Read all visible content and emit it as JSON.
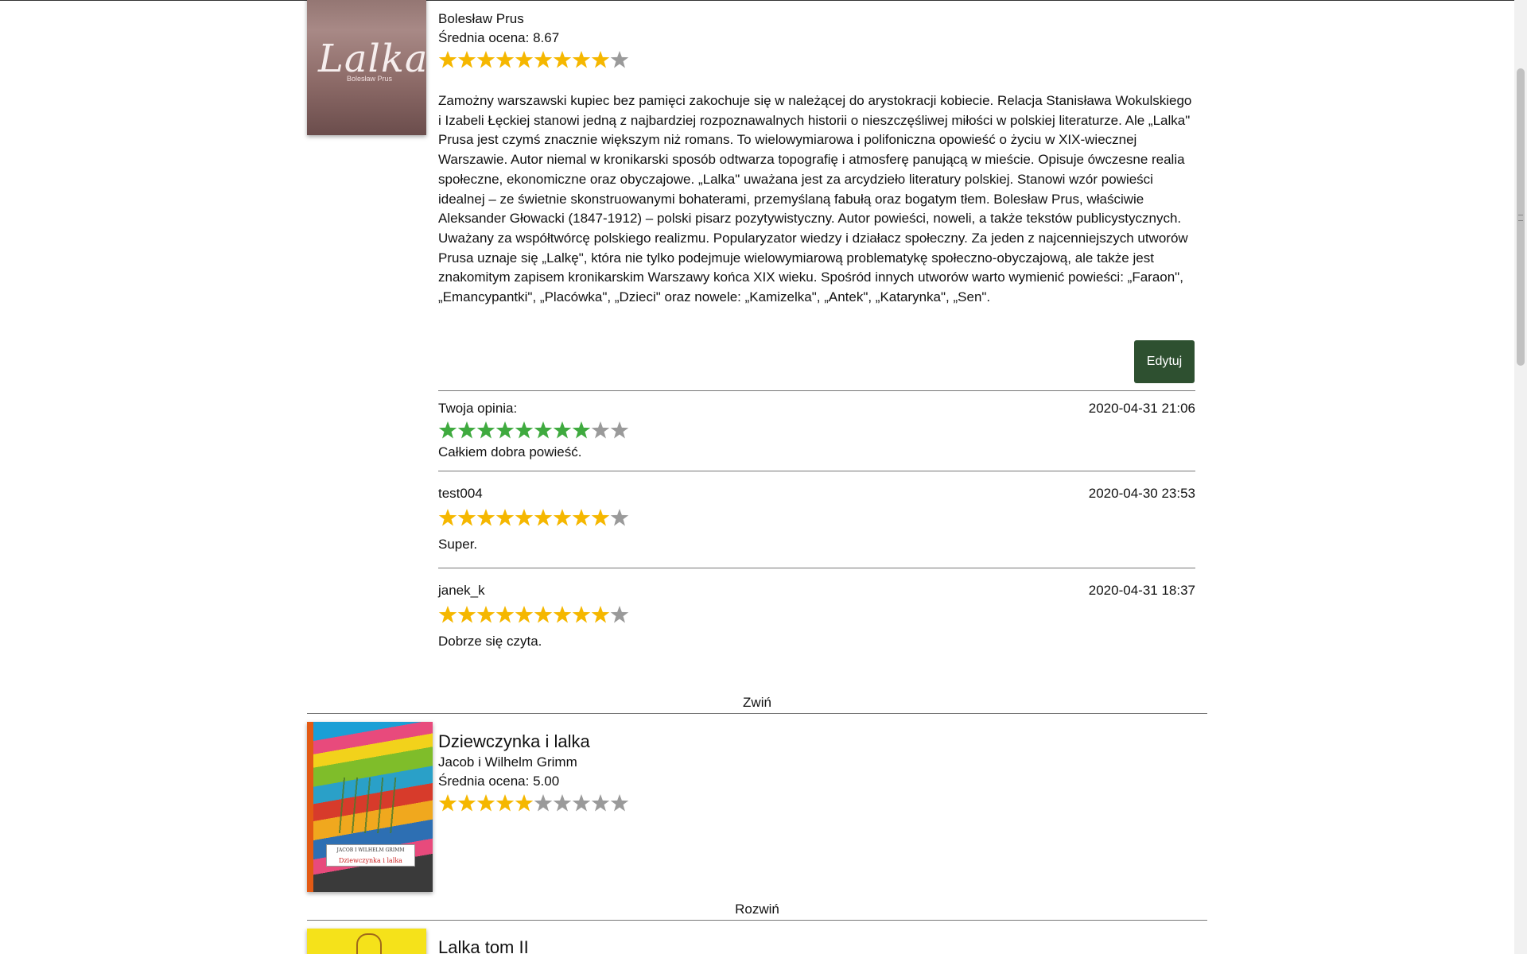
{
  "books": [
    {
      "title": "Lalka",
      "author": "Bolesław Prus",
      "rating_label": "Średnia ocena: 8.67",
      "rating_stars": 9,
      "cover_title": "Lalka",
      "cover_author": "Bolesław Prus",
      "description": "Zamożny warszawski kupiec bez pamięci zakochuje się w należącej do arystokracji kobiecie. Relacja Stanisława Wokulskiego i Izabeli Łęckiej stanowi jedną z najbardziej rozpoznawalnych historii o nieszczęśliwej miłości w polskiej literaturze. Ale „Lalka\" Prusa jest czymś znacznie większym niż romans. To wielowymiarowa i polifoniczna opowieść o życiu w XIX-wiecznej Warszawie. Autor niemal w kronikarski sposób odtwarza topografię i atmosferę panującą w mieście. Opisuje ówczesne realia społeczne, ekonomiczne oraz obyczajowe. „Lalka\" uważana jest za arcydzieło literatury polskiej. Stanowi wzór powieści idealnej – ze świetnie skonstruowanymi bohaterami, przemyślaną fabułą oraz bogatym tłem. Bolesław Prus, właściwie Aleksander Głowacki (1847-1912) – polski pisarz pozytywistyczny. Autor powieści, noweli, a także tekstów publicystycznych. Uważany za współtwórcę polskiego realizmu. Popularyzator wiedzy i działacz społeczny. Za jeden z najcenniejszych utworów Prusa uznaje się „Lalkę\", która nie tylko podejmuje wielowymiarową problematykę społeczno-obyczajową, ale także jest znakomitym zapisem kronikarskim Warszawy końca XIX wieku. Spośród innych utworów warto wymienić powieści: „Faraon\", „Emancypantki\", „Placówka\", „Dzieci\" oraz nowele: „Kamizelka\", „Antek\", „Katarynka\", „Sen\".",
      "edit_label": "Edytuj",
      "reviews": [
        {
          "author": "Twoja opinia:",
          "date": "2020-04-31 21:06",
          "stars": 8,
          "text": "Całkiem dobra powieść.",
          "own": true
        },
        {
          "author": "test004",
          "date": "2020-04-30 23:53",
          "stars": 9,
          "text": "Super.",
          "own": false
        },
        {
          "author": "janek_k",
          "date": "2020-04-31 18:37",
          "stars": 9,
          "text": "Dobrze się czyta.",
          "own": false
        }
      ],
      "toggle_label": "Zwiń"
    },
    {
      "title": "Dziewczynka i lalka",
      "author": "Jacob i Wilhelm Grimm",
      "rating_label": "Średnia ocena: 5.00",
      "rating_stars": 5,
      "cover_top_text": "JACOB I WILHELM GRIMM",
      "cover_title": "Dziewczynka i lalka",
      "toggle_label": "Rozwiń"
    },
    {
      "title": "Lalka tom II"
    }
  ],
  "max_stars": 10,
  "colors": {
    "star_on": "#f5b700",
    "star_own": "#3faa3f",
    "star_off": "#9a9a9a",
    "edit_button": "#2e5030"
  },
  "icons": [
    "star-icon"
  ]
}
